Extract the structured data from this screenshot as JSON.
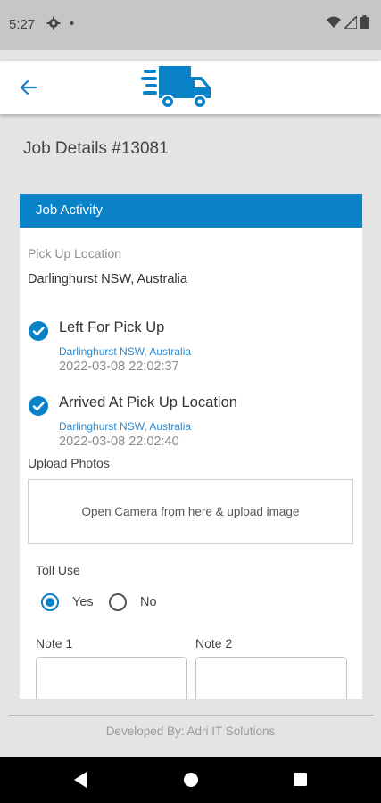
{
  "status_bar": {
    "time": "5:27",
    "dot": "•",
    "icons": [
      "gear-icon",
      "wifi-icon",
      "signal-icon",
      "battery-icon"
    ]
  },
  "app_bar": {
    "icons": [
      "back-arrow-icon",
      "delivery-truck-logo"
    ],
    "accent": "#0a82c8"
  },
  "page": {
    "title": "Job Details #13081"
  },
  "job_activity": {
    "header": "Job Activity",
    "pickup_label": "Pick Up Location",
    "pickup_value": "Darlinghurst NSW, Australia",
    "steps": [
      {
        "title": "Left For Pick Up",
        "location": "Darlinghurst NSW, Australia",
        "timestamp": "2022-03-08 22:02:37",
        "icon": "check-circle-icon"
      },
      {
        "title": "Arrived At Pick Up Location",
        "location": "Darlinghurst NSW, Australia",
        "timestamp": "2022-03-08 22:02:40",
        "icon": "check-circle-icon"
      }
    ],
    "upload_label": "Upload Photos",
    "upload_prompt": "Open Camera from here & upload image",
    "toll_label": "Toll Use",
    "toll_options": [
      {
        "label": "Yes",
        "selected": true
      },
      {
        "label": "No",
        "selected": false
      }
    ],
    "note1_label": "Note 1",
    "note2_label": "Note 2",
    "note1_value": "",
    "note2_value": ""
  },
  "footer": {
    "text": "Developed By: Adri IT Solutions"
  },
  "nav_bar": {
    "icons": [
      "back-triangle-icon",
      "home-circle-icon",
      "recents-square-icon"
    ]
  }
}
